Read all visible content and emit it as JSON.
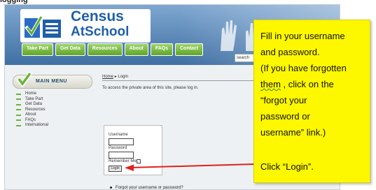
{
  "top_caption": "logging",
  "site": {
    "logo_line1": "Census",
    "logo_line2": "AtSchool",
    "nav": [
      "Take Part",
      "Get Data",
      "Resources",
      "About",
      "FAQs",
      "Contact"
    ],
    "search_value": "search"
  },
  "menu": {
    "title": "MAIN MENU",
    "items": [
      "Home",
      "Take Part",
      "Get Data",
      "Resources",
      "About",
      "FAQs",
      "International"
    ]
  },
  "content": {
    "breadcrumb_home": "Home",
    "breadcrumb_sep": "▸",
    "breadcrumb_current": "Login",
    "intro": "To access the private area of this site, please log in.",
    "username_label": "Username",
    "password_label": "Password",
    "remember_label": "Remember Me",
    "login_button": "Login",
    "forgot_link": "Forgot your username or password?"
  },
  "callout": {
    "line1": "Fill in your username",
    "line2": "and password.",
    "line3": "(If you have forgotten",
    "line4_squiggle": "them",
    "line4_rest": " , click on the",
    "line5": "“forgot your",
    "line6": "password or",
    "line7": "username” link.)",
    "click": "Click “Login”."
  },
  "colors": {
    "callout_bg": "#fdf700",
    "nav_green": "#6bb33a",
    "logo_blue": "#1f5fa7",
    "arrow_red": "#e0221b"
  },
  "icons": [
    "census-logo-check-icon",
    "menu-check-icon",
    "raised-hands-icon",
    "arrow-icon"
  ]
}
